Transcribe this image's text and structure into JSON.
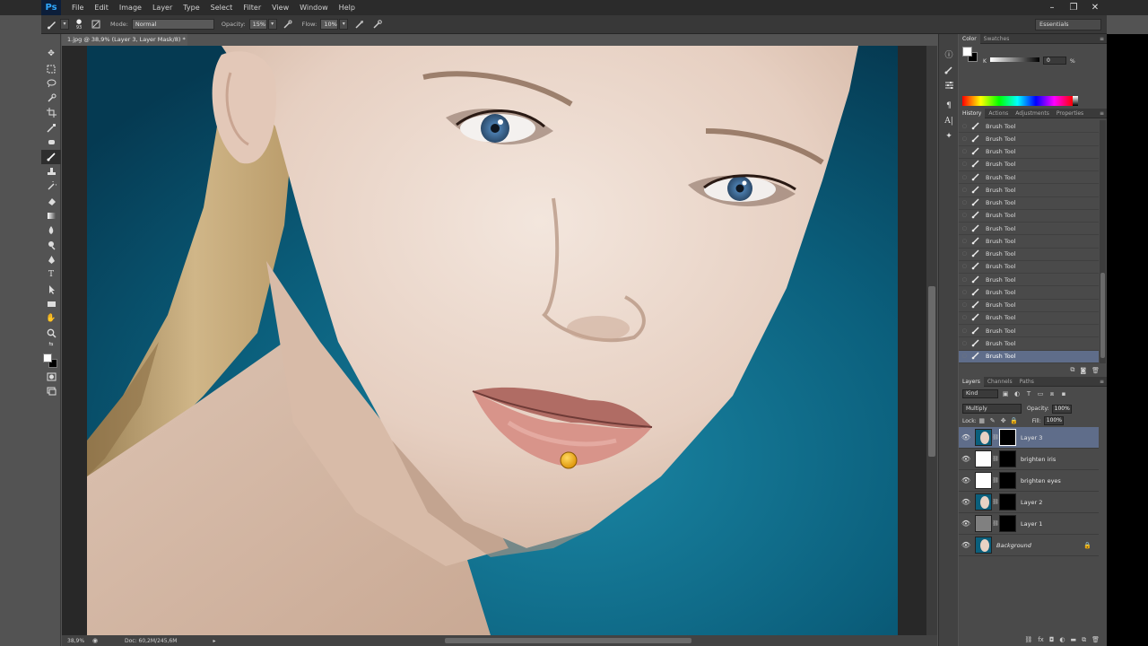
{
  "app": {
    "logo": "Ps"
  },
  "menu": [
    "File",
    "Edit",
    "Image",
    "Layer",
    "Type",
    "Select",
    "Filter",
    "View",
    "Window",
    "Help"
  ],
  "window_controls": [
    "–",
    "❐",
    "✕"
  ],
  "options": {
    "brush_size": "93",
    "mode_label": "Mode:",
    "mode_value": "Normal",
    "opacity_label": "Opacity:",
    "opacity_value": "15%",
    "flow_label": "Flow:",
    "flow_value": "10%",
    "workspace": "Essentials"
  },
  "document": {
    "tab_title": "1.jpg @ 38,9% (Layer 3, Layer Mask/8) *",
    "zoom": "38,9%",
    "doc_info": "Doc: 60,2M/245,6M"
  },
  "color_panel": {
    "tabs": [
      "Color",
      "Swatches"
    ],
    "channel_label": "K",
    "channel_value": "0",
    "unit": "%"
  },
  "history_panel": {
    "tabs": [
      "History",
      "Actions",
      "Adjustments",
      "Properties"
    ],
    "items": [
      "Brush Tool",
      "Brush Tool",
      "Brush Tool",
      "Brush Tool",
      "Brush Tool",
      "Brush Tool",
      "Brush Tool",
      "Brush Tool",
      "Brush Tool",
      "Brush Tool",
      "Brush Tool",
      "Brush Tool",
      "Brush Tool",
      "Brush Tool",
      "Brush Tool",
      "Brush Tool",
      "Brush Tool",
      "Brush Tool",
      "Brush Tool"
    ]
  },
  "layers_panel": {
    "tabs": [
      "Layers",
      "Channels",
      "Paths"
    ],
    "kind": "Kind",
    "blend_mode": "Multiply",
    "opacity_label": "Opacity:",
    "opacity_value": "100%",
    "lock_label": "Lock:",
    "fill_label": "Fill:",
    "fill_value": "100%",
    "layers": [
      {
        "name": "Layer 3",
        "selected": true
      },
      {
        "name": "brighten iris"
      },
      {
        "name": "brighten eyes"
      },
      {
        "name": "Layer 2"
      },
      {
        "name": "Layer 1"
      },
      {
        "name": "Background",
        "italic": true,
        "locked": true
      }
    ]
  },
  "colors": {
    "canvas_bg": "#0a5872",
    "selection": "#5f6d8a",
    "brush_cursor": "#f0b020"
  }
}
